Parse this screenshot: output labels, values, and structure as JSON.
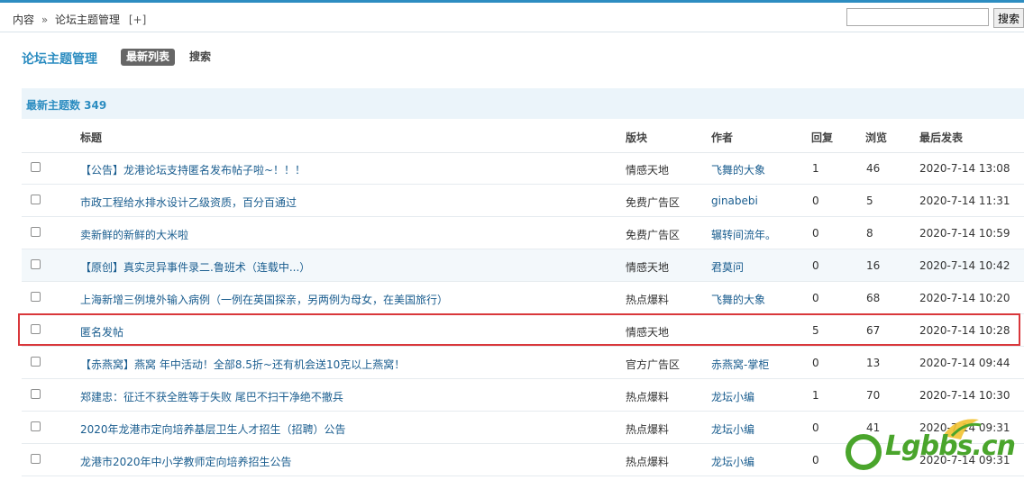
{
  "breadcrumb": {
    "home": "内容",
    "separator": "»",
    "current": "论坛主题管理",
    "plus": "[+]"
  },
  "search": {
    "placeholder": "",
    "button": "搜索"
  },
  "header": {
    "title": "论坛主题管理",
    "tabs": [
      "最新列表",
      "搜索"
    ]
  },
  "summary": "最新主题数 349",
  "table": {
    "headers": [
      "标题",
      "版块",
      "作者",
      "回复",
      "浏览",
      "最后发表"
    ],
    "rows": [
      {
        "title": "【公告】龙港论坛支持匿名发布帖子啦~！！！",
        "board": "情感天地",
        "author": "飞舞的大象",
        "replies": "1",
        "views": "46",
        "last": "2020-7-14 13:08"
      },
      {
        "title": "市政工程给水排水设计乙级资质，百分百通过",
        "board": "免费广告区",
        "author": "ginabebi",
        "replies": "0",
        "views": "5",
        "last": "2020-7-14 11:31"
      },
      {
        "title": "卖新鲜的新鲜的大米啦",
        "board": "免费广告区",
        "author": "辗转间流年。",
        "replies": "0",
        "views": "8",
        "last": "2020-7-14 10:59"
      },
      {
        "title": "【原创】真实灵异事件录二.鲁班术（连载中...）",
        "board": "情感天地",
        "author": "君莫问",
        "replies": "0",
        "views": "16",
        "last": "2020-7-14 10:42"
      },
      {
        "title": "上海新增三例境外输入病例（一例在英国探亲，另两例为母女，在美国旅行）",
        "board": "热点爆料",
        "author": "飞舞的大象",
        "replies": "0",
        "views": "68",
        "last": "2020-7-14 10:20"
      },
      {
        "title": "匿名发帖",
        "board": "情感天地",
        "author": "",
        "replies": "5",
        "views": "67",
        "last": "2020-7-14 10:28"
      },
      {
        "title": "【赤燕窝】燕窝 年中活动！全部8.5折~还有机会送10克以上燕窝！",
        "board": "官方广告区",
        "author": "赤燕窝-掌柜",
        "replies": "0",
        "views": "13",
        "last": "2020-7-14 09:44"
      },
      {
        "title": "郑建忠：征迁不获全胜等于失败 尾巴不扫干净绝不撤兵",
        "board": "热点爆料",
        "author": "龙坛小编",
        "replies": "1",
        "views": "70",
        "last": "2020-7-14 10:30"
      },
      {
        "title": "2020年龙港市定向培养基层卫生人才招生（招聘）公告",
        "board": "热点爆料",
        "author": "龙坛小编",
        "replies": "0",
        "views": "41",
        "last": "2020-7-14 09:31"
      },
      {
        "title": "龙港市2020年中小学教师定向培养招生公告",
        "board": "热点爆料",
        "author": "龙坛小编",
        "replies": "0",
        "views": "",
        "last": "2020-7-14 09:31"
      }
    ]
  },
  "watermark": {
    "text": "Lgbbs.cn",
    "color": "#4aa52c"
  },
  "colors": {
    "accent": "#2d8dc1",
    "highlight_border": "#d9373b"
  }
}
